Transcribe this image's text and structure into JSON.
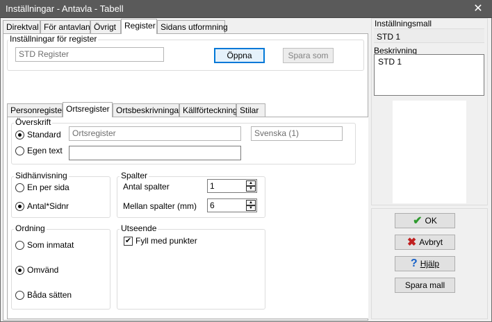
{
  "window": {
    "title": "Inställningar - Antavla - Tabell",
    "close_glyph": "✕"
  },
  "top_tabs": [
    "Direktval",
    "För antavlan",
    "Övrigt",
    "Register",
    "Sidans utformning"
  ],
  "register_settings": {
    "legend": "Inställningar för register",
    "name_value": "STD Register",
    "open_label": "Öppna",
    "save_as_label": "Spara som"
  },
  "sub_tabs": [
    "Personregister",
    "Ortsregister",
    "Ortsbeskrivningar",
    "Källförteckning",
    "Stilar"
  ],
  "heading": {
    "legend": "Överskrift",
    "standard_label": "Standard",
    "standard_value": "Ortsregister",
    "language_value": "Svenska (1)",
    "own_text_label": "Egen text",
    "own_text_value": ""
  },
  "page_ref": {
    "legend": "Sidhänvisning",
    "opt1": "En per sida",
    "opt2": "Antal*Sidnr"
  },
  "columns": {
    "legend": "Spalter",
    "count_label": "Antal spalter",
    "count_value": "1",
    "gap_label": "Mellan spalter (mm)",
    "gap_value": "6"
  },
  "order": {
    "legend": "Ordning",
    "opt1": "Som inmatat",
    "opt2": "Omvänd",
    "opt3": "Båda sätten"
  },
  "appearance": {
    "legend": "Utseende",
    "fill_label": "Fyll med punkter",
    "check_glyph": "✔"
  },
  "template": {
    "title": "Inställningsmall",
    "value": "STD 1",
    "desc_label": "Beskrivning",
    "desc_value": "STD 1"
  },
  "buttons": {
    "ok": "OK",
    "cancel": "Avbryt",
    "help": "Hjälp",
    "save_template": "Spara mall",
    "ok_glyph": "✔",
    "cancel_glyph": "✖",
    "help_glyph": "?"
  },
  "icons": {
    "ok": "check-icon",
    "cancel": "cross-icon",
    "help": "question-icon",
    "close": "close-icon"
  },
  "colors": {
    "titlebar": "#5a5a5a",
    "ok_icon": "#2e9a2e",
    "cancel_icon": "#c02020",
    "help_icon": "#1560c8",
    "focus": "#0078d7"
  }
}
